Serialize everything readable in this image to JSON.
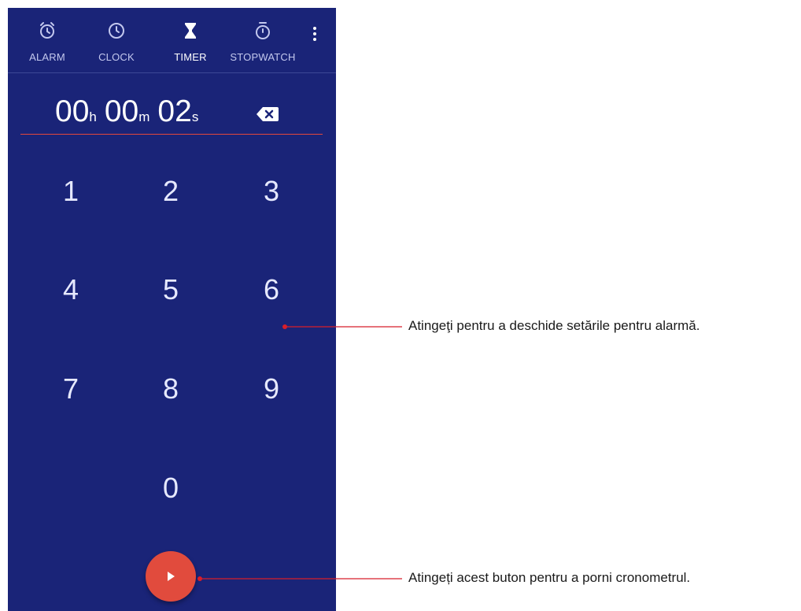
{
  "tabs": [
    {
      "label": "ALARM",
      "icon": "alarm-icon"
    },
    {
      "label": "CLOCK",
      "icon": "clock-icon"
    },
    {
      "label": "TIMER",
      "icon": "hourglass-icon",
      "active": true
    },
    {
      "label": "STOPWATCH",
      "icon": "stopwatch-icon"
    }
  ],
  "overflow_icon": "more-vert-icon",
  "timer": {
    "hours": "00",
    "hours_unit": "h",
    "minutes": "00",
    "minutes_unit": "m",
    "seconds": "02",
    "seconds_unit": "s"
  },
  "keypad": [
    "1",
    "2",
    "3",
    "4",
    "5",
    "6",
    "7",
    "8",
    "9",
    "0"
  ],
  "start_button_icon": "play-icon",
  "annotations": {
    "settings": "Atingeţi pentru a deschide setările pentru alarmă.",
    "start": "Atingeți acest buton pentru a porni cronometrul."
  },
  "colors": {
    "background": "#1a2478",
    "accent": "#e14b3d",
    "underline": "#e2483c"
  }
}
